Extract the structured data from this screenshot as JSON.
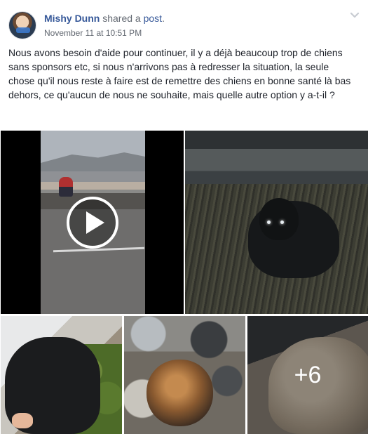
{
  "post": {
    "author": "Mishy Dunn",
    "shared_text": "shared a",
    "shared_link": "post",
    "timestamp": "November 11 at 10:51 PM",
    "body": "Nous avons besoin d'aide pour continuer, il y a déjà beaucoup trop de chiens sans sponsors etc, si nous n'arrivons pas à redresser la situation, la seule chose qu'il nous reste à faire est de remettre des chiens en bonne santé là bas dehors, ce qu'aucun de nous ne souhaite, mais quelle autre option y a-t-il ?"
  },
  "icons": {
    "menu": "chevron-down-icon",
    "video": "play-icon"
  },
  "gallery": {
    "more_count": "+6"
  },
  "colors": {
    "link": "#365899",
    "meta": "#616770",
    "text": "#1d2129"
  }
}
